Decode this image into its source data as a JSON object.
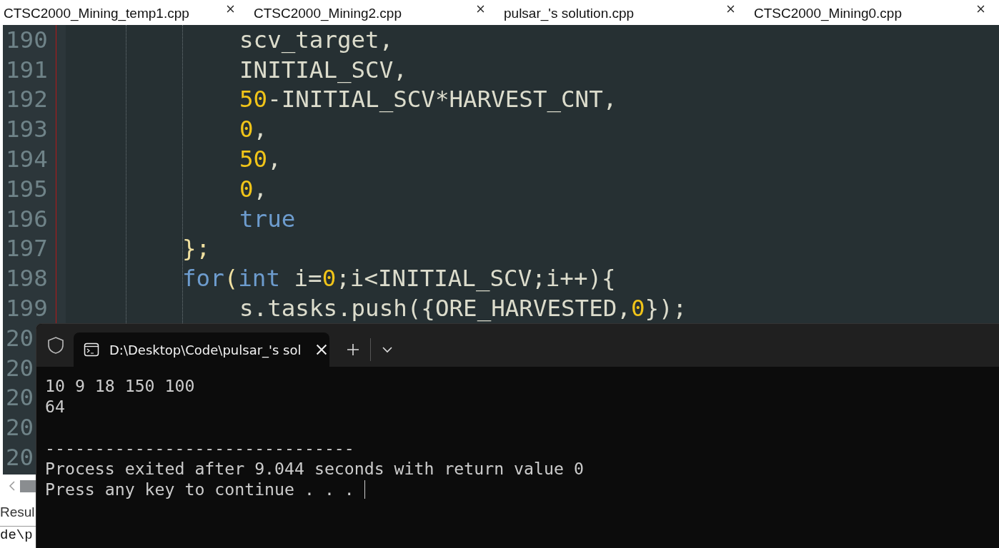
{
  "tabs": [
    {
      "label": "CTSC2000_Mining_temp1.cpp"
    },
    {
      "label": "CTSC2000_Mining2.cpp"
    },
    {
      "label": "pulsar_'s solution.cpp"
    },
    {
      "label": "CTSC2000_Mining0.cpp"
    }
  ],
  "editor": {
    "lines": [
      {
        "number": "190",
        "kind": "arg",
        "tokens": [
          {
            "text": "scv_target,",
            "kind": "ident"
          }
        ]
      },
      {
        "number": "191",
        "kind": "arg",
        "tokens": [
          {
            "text": "INITIAL_SCV,",
            "kind": "ident"
          }
        ]
      },
      {
        "number": "192",
        "kind": "arg",
        "tokens": [
          {
            "text": "50",
            "kind": "num"
          },
          {
            "text": "-INITIAL_SCV*HARVEST_CNT,",
            "kind": "ident"
          }
        ]
      },
      {
        "number": "193",
        "kind": "arg",
        "tokens": [
          {
            "text": "0",
            "kind": "num"
          },
          {
            "text": ",",
            "kind": "ident"
          }
        ]
      },
      {
        "number": "194",
        "kind": "arg",
        "tokens": [
          {
            "text": "50",
            "kind": "num"
          },
          {
            "text": ",",
            "kind": "ident"
          }
        ]
      },
      {
        "number": "195",
        "kind": "arg",
        "tokens": [
          {
            "text": "0",
            "kind": "num"
          },
          {
            "text": ",",
            "kind": "ident"
          }
        ]
      },
      {
        "number": "196",
        "kind": "arg",
        "tokens": [
          {
            "text": "true",
            "kind": "kw"
          }
        ]
      },
      {
        "number": "197",
        "kind": "statement",
        "tokens": [
          {
            "text": "};",
            "kind": "punct"
          }
        ]
      },
      {
        "number": "198",
        "kind": "statement",
        "tokens": [
          {
            "text": "for",
            "kind": "kw"
          },
          {
            "text": "(",
            "kind": "punct"
          },
          {
            "text": "int",
            "kind": "kw"
          },
          {
            "text": " i=",
            "kind": "ident"
          },
          {
            "text": "0",
            "kind": "num"
          },
          {
            "text": ";i<INITIAL_SCV;i++){",
            "kind": "ident"
          }
        ]
      },
      {
        "number": "199",
        "kind": "arg",
        "tokens": [
          {
            "text": "s.tasks.push({ORE_HARVESTED,",
            "kind": "ident"
          },
          {
            "text": "0",
            "kind": "num"
          },
          {
            "text": "});",
            "kind": "ident"
          }
        ]
      },
      {
        "number": "20"
      },
      {
        "number": "20"
      },
      {
        "number": "20"
      },
      {
        "number": "20"
      },
      {
        "number": "20"
      }
    ]
  },
  "bottom_panel": {
    "tab": "Resul",
    "log": "de\\p"
  },
  "terminal": {
    "tab_title": "D:\\Desktop\\Code\\pulsar_'s sol",
    "output": [
      {
        "kind": "line",
        "text": "10 9 18 150 100"
      },
      {
        "kind": "line",
        "text": "64"
      },
      {
        "kind": "blank"
      },
      {
        "kind": "line",
        "text": "-------------------------------"
      },
      {
        "kind": "line",
        "text": "Process exited after 9.044 seconds with return value 0"
      },
      {
        "kind": "line",
        "text": "Press any key to continue . . ."
      }
    ]
  }
}
